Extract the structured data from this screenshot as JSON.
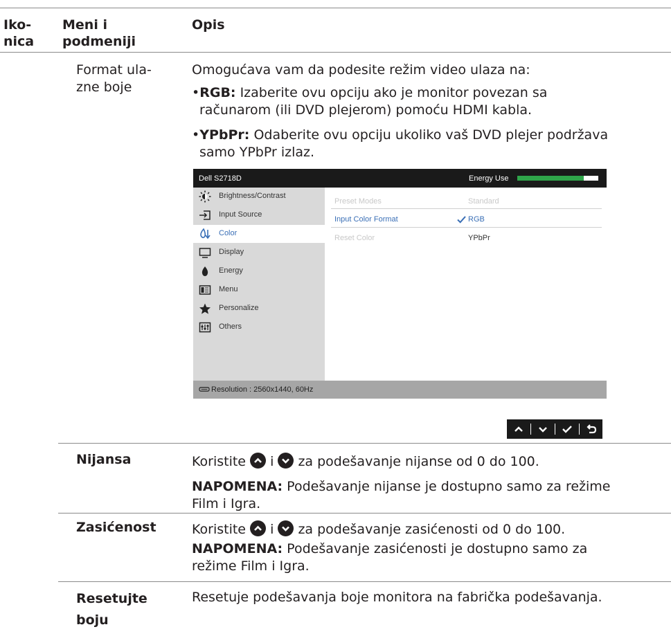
{
  "header": {
    "col1": "Iko-\nnica",
    "col1_a": "Iko-",
    "col1_b": "nica",
    "col2_a": "Meni i",
    "col2_b": "podmeniji",
    "col3": "Opis"
  },
  "format": {
    "name_a": "Format ula-",
    "name_b": "zne boje",
    "intro": "Omogućava vam da podesite režim video ulaza na:",
    "rgb_label": "RGB:",
    "rgb_text_a": " Izaberite ovu opciju ako je monitor povezan sa",
    "rgb_text_b": "računarom (ili DVD plejerom) pomoću HDMI kabla.",
    "ypbpr_label": "YPbPr:",
    "ypbpr_text_a": " Odaberite ovu opciju ukoliko vaš DVD plejer podržava",
    "ypbpr_text_b": "samo YPbPr izlaz."
  },
  "osd": {
    "model": "Dell S2718D",
    "energy_label": "Energy Use",
    "energy_level_fraction": 0.82,
    "menu": [
      {
        "label": "Brightness/Contrast",
        "icon": "brightness-icon"
      },
      {
        "label": "Input Source",
        "icon": "input-source-icon"
      },
      {
        "label": "Color",
        "icon": "color-icon",
        "selected": true
      },
      {
        "label": "Display",
        "icon": "display-icon"
      },
      {
        "label": "Energy",
        "icon": "energy-icon"
      },
      {
        "label": "Menu",
        "icon": "menu-icon"
      },
      {
        "label": "Personalize",
        "icon": "star-icon"
      },
      {
        "label": "Others",
        "icon": "others-icon"
      }
    ],
    "rows": [
      {
        "label": "Preset Modes",
        "value": "Standard"
      },
      {
        "label": "Input Color Format",
        "value": "RGB"
      },
      {
        "label": "Reset Color",
        "value": "YPbPr"
      }
    ],
    "resolution": "Resolution : 2560x1440, 60Hz",
    "nav_buttons": [
      "up-icon",
      "down-icon",
      "check-icon",
      "back-icon"
    ]
  },
  "nijansa": {
    "name": "Nijansa",
    "line1_a": "Koristite ",
    "line1_i": " i ",
    "line1_b": " za podešavanje nijanse od 0 do 100.",
    "note_label": "NAPOMENA:",
    "note_a": " Podešavanje nijanse je dostupno samo za režime",
    "note_b": "Film i Igra."
  },
  "zasicenost": {
    "name": "Zasićenost",
    "line1_a": "Koristite ",
    "line1_i": " i ",
    "line1_b": "  za podešavanje zasićenosti od 0 do 100.",
    "note_label": "NAPOMENA:",
    "note_a": " Podešavanje zasićenosti je dostupno samo za",
    "note_b": "režime Film i Igra."
  },
  "reset": {
    "name_a": "Resetujte",
    "name_b": "boju",
    "text": "Resetuje podešavanja boje monitora na fabrička podešavanja."
  },
  "colors": {
    "text": "#231f20",
    "osd_dark": "#1a1a1a",
    "osd_side": "#d9d9d9",
    "osd_accent": "#3a6fb6",
    "energy_green": "#2fa64a"
  }
}
